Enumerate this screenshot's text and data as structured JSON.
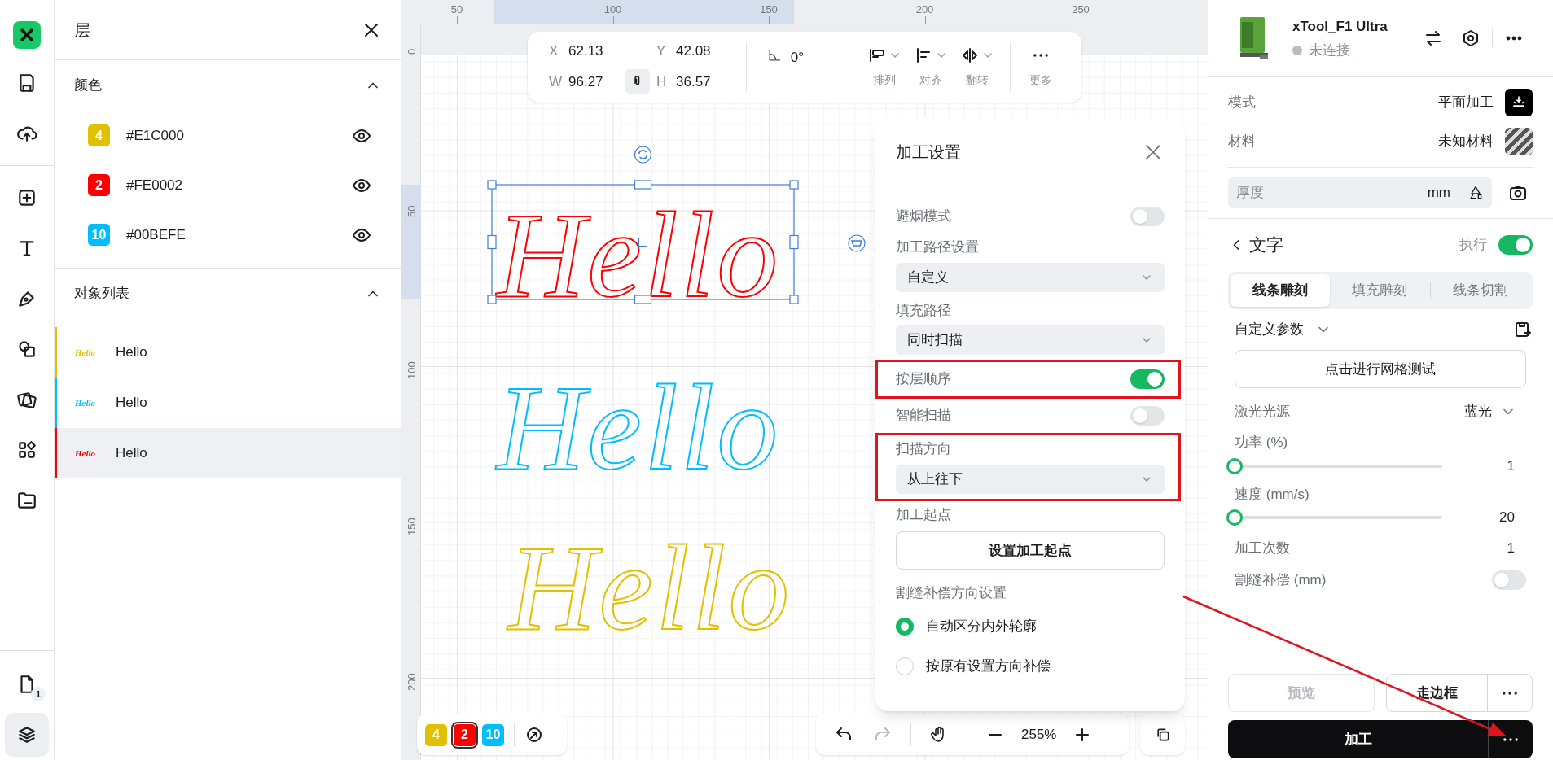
{
  "tools": [
    {
      "kind": "logo",
      "selected": false
    },
    {
      "kind": "save",
      "selected": false
    },
    {
      "kind": "upload",
      "selected": false
    },
    {
      "kind": "add",
      "selected": false
    },
    {
      "kind": "text",
      "selected": false
    },
    {
      "kind": "pen",
      "selected": false
    },
    {
      "kind": "shapes",
      "selected": false
    },
    {
      "kind": "image",
      "selected": false
    },
    {
      "kind": "apps",
      "selected": false
    },
    {
      "kind": "folder",
      "selected": false
    }
  ],
  "bottom_tools": [
    {
      "kind": "pages",
      "badge": "1",
      "selected": false
    },
    {
      "kind": "layers",
      "selected": true
    }
  ],
  "layers_panel": {
    "title": "层",
    "colors": {
      "title": "颜色",
      "expanded": true,
      "items": [
        {
          "label": "4",
          "name": "#E1C000",
          "color": "#e1c000",
          "visible": true
        },
        {
          "label": "2",
          "name": "#FE0002",
          "color": "#fe0002",
          "visible": true
        },
        {
          "label": "10",
          "name": "#00BEFE",
          "color": "#00befe",
          "visible": true
        }
      ]
    },
    "objects": {
      "title": "对象列表",
      "expanded": true,
      "items": [
        {
          "thumbnail": "Hello",
          "name": "Hello",
          "color": "#e1c000",
          "selected": false
        },
        {
          "thumbnail": "Hello",
          "name": "Hello",
          "color": "#00befe",
          "selected": false
        },
        {
          "thumbnail": "Hello",
          "name": "Hello",
          "color": "#fe0002",
          "selected": true
        }
      ]
    }
  },
  "canvas": {
    "x_ticks": [
      "50",
      "100",
      "150",
      "200",
      "250"
    ],
    "y_ticks": [
      "0",
      "50",
      "100",
      "150",
      "200"
    ],
    "objects": [
      {
        "text": "Hello",
        "selected": true
      },
      {
        "text": "Hello",
        "selected": false
      },
      {
        "text": "Hello",
        "selected": false
      }
    ],
    "toolbar": {
      "fields": [
        {
          "label": "X",
          "value": "62.13"
        },
        {
          "label": "Y",
          "value": "42.08"
        },
        {
          "label": "W",
          "value": "96.27"
        },
        {
          "label": "H",
          "value": "36.57"
        }
      ],
      "angle": "0°",
      "actions": [
        {
          "kind": "arrange",
          "label": "排列"
        },
        {
          "kind": "align",
          "label": "对齐"
        },
        {
          "kind": "flip",
          "label": "翻转"
        },
        {
          "kind": "more",
          "label": "更多"
        }
      ]
    },
    "layer_chips": [
      {
        "label": "4",
        "color": "#e1c000",
        "selected": false
      },
      {
        "label": "2",
        "color": "#fe0002",
        "selected": true
      },
      {
        "label": "10",
        "color": "#00befe",
        "selected": false
      }
    ],
    "zoom": "255%"
  },
  "dialog": {
    "title": "加工设置",
    "rows": [
      {
        "kind": "toggle",
        "label": "避烟模式",
        "on": false,
        "highlighted": false
      },
      {
        "kind": "select",
        "label": "加工路径设置",
        "value": "自定义",
        "highlighted": false
      },
      {
        "kind": "select",
        "label": "填充路径",
        "value": "同时扫描",
        "highlighted": false
      },
      {
        "kind": "toggle",
        "label": "按层顺序",
        "on": true,
        "highlighted": true
      },
      {
        "kind": "toggle",
        "label": "智能扫描",
        "on": false,
        "highlighted": false
      },
      {
        "kind": "select",
        "label": "扫描方向",
        "value": "从上往下",
        "highlighted": true
      },
      {
        "kind": "button",
        "label": "加工起点",
        "button": "设置加工起点",
        "highlighted": false
      },
      {
        "kind": "radio",
        "label": "割缝补偿方向设置",
        "highlighted": false,
        "options": [
          {
            "label": "自动区分内外轮廓",
            "selected": true
          },
          {
            "label": "按原有设置方向补偿",
            "selected": false
          }
        ]
      }
    ]
  },
  "right_panel": {
    "device": {
      "name": "xTool_F1 Ultra",
      "status": "未连接"
    },
    "mode": {
      "label": "模式",
      "value": "平面加工"
    },
    "material": {
      "label": "材料",
      "value": "未知材料"
    },
    "thickness": {
      "placeholder": "厚度",
      "unit": "mm"
    },
    "section": {
      "title": "文字",
      "execute_label": "执行",
      "execute_on": true
    },
    "tabs": [
      {
        "label": "线条雕刻",
        "selected": true
      },
      {
        "label": "填充雕刻",
        "selected": false
      },
      {
        "label": "线条切割",
        "selected": false
      }
    ],
    "preset": "自定义参数",
    "grid_test": "点击进行网格测试",
    "params": [
      {
        "kind": "select",
        "label": "激光光源",
        "value": "蓝光"
      },
      {
        "kind": "slider",
        "label": "功率 (%)",
        "level": 0,
        "value": "1"
      },
      {
        "kind": "slider",
        "label": "速度 (mm/s)",
        "level": 0,
        "value": "20"
      },
      {
        "kind": "value",
        "label": "加工次数",
        "value": "1"
      },
      {
        "kind": "toggle",
        "label": "割缝补偿 (mm)",
        "on": false
      }
    ],
    "footer": {
      "preview": {
        "label": "预览",
        "disabled": true
      },
      "frame": "走边框",
      "process": "加工"
    }
  }
}
